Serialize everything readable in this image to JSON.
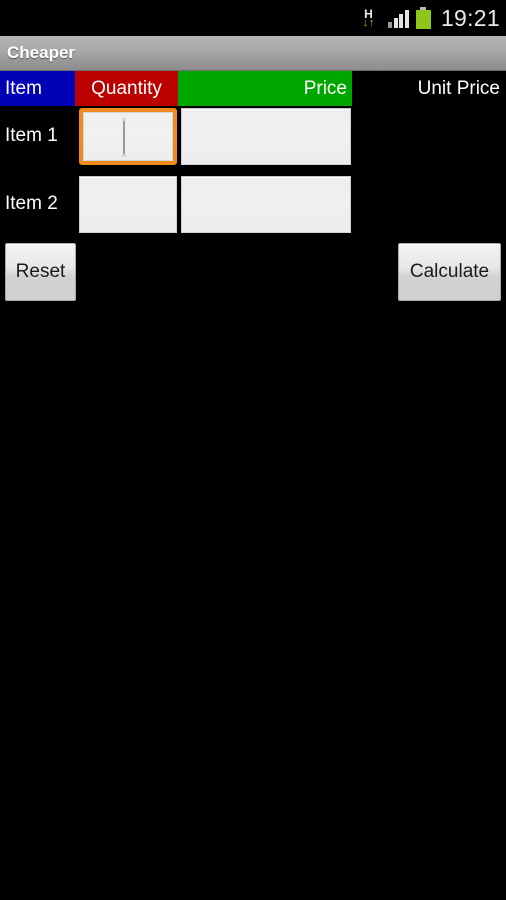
{
  "status_bar": {
    "network_type": "H",
    "data_arrows": {
      "down": "↓",
      "up": "↑"
    },
    "signal_label": "signal-4-bars",
    "battery_label": "battery-full",
    "time": "19:21"
  },
  "title_bar": {
    "app_title": "Cheaper"
  },
  "table": {
    "headers": [
      {
        "label": "Item",
        "color": "#0000b4",
        "align": "left"
      },
      {
        "label": "Quantity",
        "color": "#bb0000",
        "align": "center"
      },
      {
        "label": "Price",
        "color": "#00a600",
        "align": "right"
      },
      {
        "label": "Unit Price",
        "color": "#000000",
        "align": "right"
      }
    ],
    "rows": [
      {
        "label": "Item 1",
        "quantity_value": "",
        "quantity_placeholder": "",
        "price_value": "",
        "price_placeholder": "",
        "unit_price": "",
        "quantity_focused": true
      },
      {
        "label": "Item 2",
        "quantity_value": "",
        "quantity_placeholder": "",
        "price_value": "",
        "price_placeholder": "",
        "unit_price": "",
        "quantity_focused": false
      }
    ]
  },
  "buttons": {
    "reset_label": "Reset",
    "calculate_label": "Calculate"
  },
  "colors": {
    "background": "#000000",
    "title_bar": "#a9a9a9",
    "header_item": "#0000b4",
    "header_quantity": "#bb0000",
    "header_price": "#00a600",
    "header_unit_price": "#000000",
    "focus_highlight": "#f08a1e",
    "field_background": "#eeeeee",
    "battery_green": "#8ec61a",
    "text_white": "#ffffff"
  }
}
